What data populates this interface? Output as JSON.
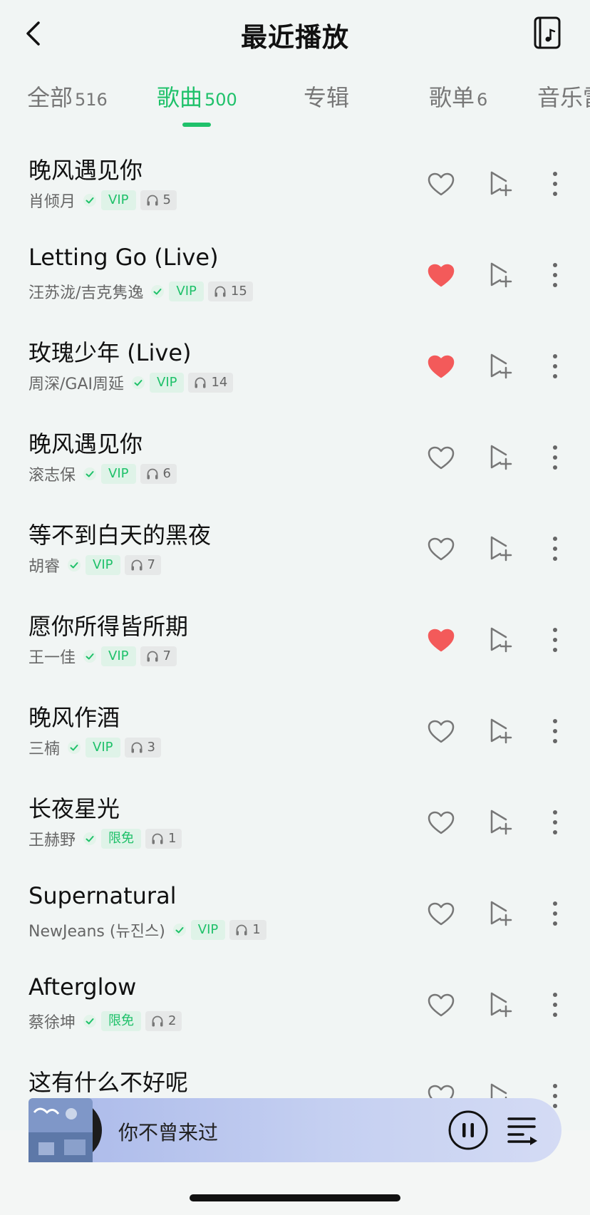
{
  "header": {
    "title": "最近播放",
    "back_icon": "chevron-left-icon",
    "local_icon": "music-file-icon"
  },
  "tabs": [
    {
      "label": "全部",
      "count": "516",
      "active": false
    },
    {
      "label": "歌曲",
      "count": "500",
      "active": true
    },
    {
      "label": "专辑",
      "count": "",
      "active": false
    },
    {
      "label": "歌单",
      "count": "6",
      "active": false
    },
    {
      "label": "音乐雷",
      "count": "",
      "active": false
    }
  ],
  "songs": [
    {
      "title": "晚风遇见你",
      "artist": "肖倾月",
      "badge": "VIP",
      "plays": "5",
      "liked": false
    },
    {
      "title": "Letting Go (Live)",
      "artist": "汪苏泷/吉克隽逸",
      "badge": "VIP",
      "plays": "15",
      "liked": true
    },
    {
      "title": "玫瑰少年 (Live)",
      "artist": "周深/GAI周延",
      "badge": "VIP",
      "plays": "14",
      "liked": true
    },
    {
      "title": "晚风遇见你",
      "artist": "滚志保",
      "badge": "VIP",
      "plays": "6",
      "liked": false
    },
    {
      "title": "等不到白天的黑夜",
      "artist": "胡睿",
      "badge": "VIP",
      "plays": "7",
      "liked": false
    },
    {
      "title": "愿你所得皆所期",
      "artist": "王一佳",
      "badge": "VIP",
      "plays": "7",
      "liked": true
    },
    {
      "title": "晚风作酒",
      "artist": "三楠",
      "badge": "VIP",
      "plays": "3",
      "liked": false
    },
    {
      "title": "长夜星光",
      "artist": "王赫野",
      "badge": "限免",
      "plays": "1",
      "liked": false
    },
    {
      "title": "Supernatural",
      "artist": "NewJeans (뉴진스)",
      "badge": "VIP",
      "plays": "1",
      "liked": false
    },
    {
      "title": "Afterglow",
      "artist": "蔡徐坤",
      "badge": "限免",
      "plays": "2",
      "liked": false
    },
    {
      "title": "这有什么不好呢",
      "artist": "",
      "badge": "",
      "plays": "",
      "liked": false
    }
  ],
  "player": {
    "now_playing": "你不曾来过",
    "pause_icon": "pause-icon",
    "queue_icon": "playlist-icon"
  },
  "colors": {
    "accent": "#1fc16a",
    "liked": "#f35a5a",
    "background": "#f1f5f4"
  }
}
